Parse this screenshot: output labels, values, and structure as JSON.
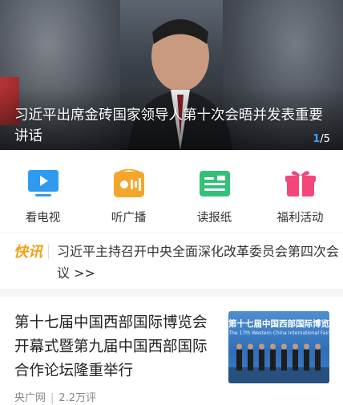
{
  "hero": {
    "title": "习近平出席金砖国家领导人第十次会晤并发表重要讲话",
    "pager_current": "1",
    "pager_total": "/5"
  },
  "quick_links": [
    {
      "label": "看电视",
      "icon": "tv-icon",
      "color": "#2f9bf0"
    },
    {
      "label": "听广播",
      "icon": "radio-icon",
      "color": "#f3a629"
    },
    {
      "label": "读报纸",
      "icon": "newspaper-icon",
      "color": "#35c07a"
    },
    {
      "label": "福利活动",
      "icon": "gift-icon",
      "color": "#f2477a"
    }
  ],
  "ticker": {
    "tag": "快讯",
    "text": "习近平主持召开中央全面深化改革委员会第四次会议 >>"
  },
  "article": {
    "title": "第十七届中国西部国际博览会开幕式暨第九届中国西部国际合作论坛隆重举行",
    "source": "央广网",
    "separator": "|",
    "comments": "2.2万评",
    "thumb_title": "第十七届中国西部国际博览",
    "thumb_subtitle": "The 17th Western China International Fair"
  }
}
